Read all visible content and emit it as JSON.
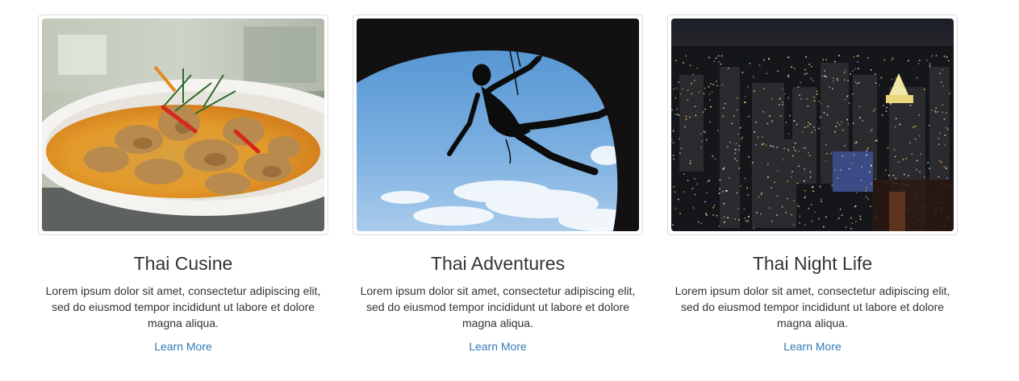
{
  "cards": [
    {
      "title": "Thai Cusine",
      "description": "Lorem ipsum dolor sit amet, consectetur adipiscing elit, sed do eiusmod tempor incididunt ut labore et dolore magna aliqua.",
      "link_label": "Learn More",
      "image": "thai-curry-dish-photo"
    },
    {
      "title": "Thai Adventures",
      "description": "Lorem ipsum dolor sit amet, consectetur adipiscing elit, sed do eiusmod tempor incididunt ut labore et dolore magna aliqua.",
      "link_label": "Learn More",
      "image": "rock-climber-silhouette-photo"
    },
    {
      "title": "Thai Night Life",
      "description": "Lorem ipsum dolor sit amet, consectetur adipiscing elit, sed do eiusmod tempor incididunt ut labore et dolore magna aliqua.",
      "link_label": "Learn More",
      "image": "bangkok-night-skyline-photo"
    }
  ],
  "colors": {
    "link": "#337ab7",
    "text": "#333333",
    "thumbnail_border": "#dddddd"
  }
}
